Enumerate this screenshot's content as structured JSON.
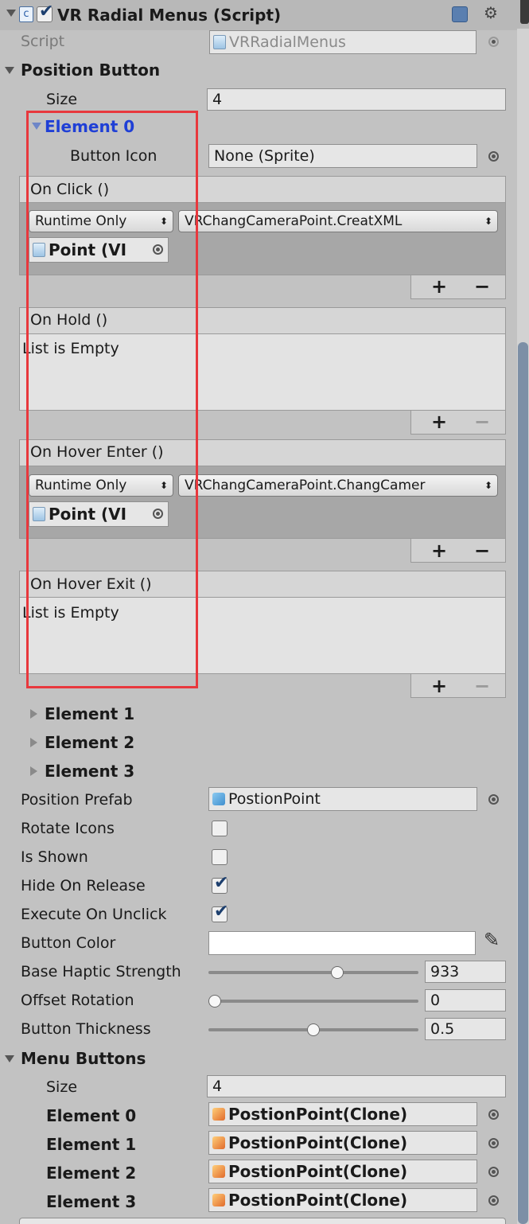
{
  "header": {
    "component_title": "VR Radial Menus (Script)",
    "script_label": "Script",
    "script_value": "VRRadialMenus"
  },
  "position_button": {
    "label": "Position Button",
    "size_label": "Size",
    "size_value": "4",
    "element0": {
      "label": "Element 0",
      "button_icon_label": "Button Icon",
      "button_icon_value": "None (Sprite)",
      "on_click": {
        "label": "On Click ()",
        "runtime": "Runtime Only",
        "function": "VRChangCameraPoint.CreatXML",
        "object": "Point (VI"
      },
      "on_hold": {
        "label": "On Hold ()",
        "empty": "List is Empty"
      },
      "on_hover_enter": {
        "label": "On Hover Enter ()",
        "runtime": "Runtime Only",
        "function": "VRChangCameraPoint.ChangCamer",
        "object": "Point (VI"
      },
      "on_hover_exit": {
        "label": "On Hover Exit ()",
        "empty": "List is Empty"
      }
    },
    "collapsed": [
      "Element 1",
      "Element 2",
      "Element 3"
    ]
  },
  "props": {
    "position_prefab_label": "Position Prefab",
    "position_prefab_value": "PostionPoint",
    "rotate_icons_label": "Rotate Icons",
    "rotate_icons": false,
    "is_shown_label": "Is Shown",
    "is_shown": false,
    "hide_on_release_label": "Hide On Release",
    "hide_on_release": true,
    "execute_on_unclick_label": "Execute On Unclick",
    "execute_on_unclick": true,
    "button_color_label": "Button Color",
    "button_color": "#ffffff",
    "base_haptic_label": "Base Haptic Strength",
    "base_haptic_value": "933",
    "base_haptic_fraction": 0.62,
    "offset_rotation_label": "Offset Rotation",
    "offset_rotation_value": "0",
    "offset_rotation_fraction": 0.0,
    "button_thickness_label": "Button Thickness",
    "button_thickness_value": "0.5",
    "button_thickness_fraction": 0.5
  },
  "menu_buttons": {
    "label": "Menu Buttons",
    "size_label": "Size",
    "size_value": "4",
    "elements": [
      {
        "label": "Element 0",
        "value": "PostionPoint(Clone)"
      },
      {
        "label": "Element 1",
        "value": "PostionPoint(Clone)"
      },
      {
        "label": "Element 2",
        "value": "PostionPoint(Clone)"
      },
      {
        "label": "Element 3",
        "value": "PostionPoint(Clone)"
      }
    ]
  },
  "list_buttons": {
    "plus": "+",
    "minus": "−"
  },
  "highlight_color": "#e8383d",
  "accent_blue": "#1f3fd6"
}
